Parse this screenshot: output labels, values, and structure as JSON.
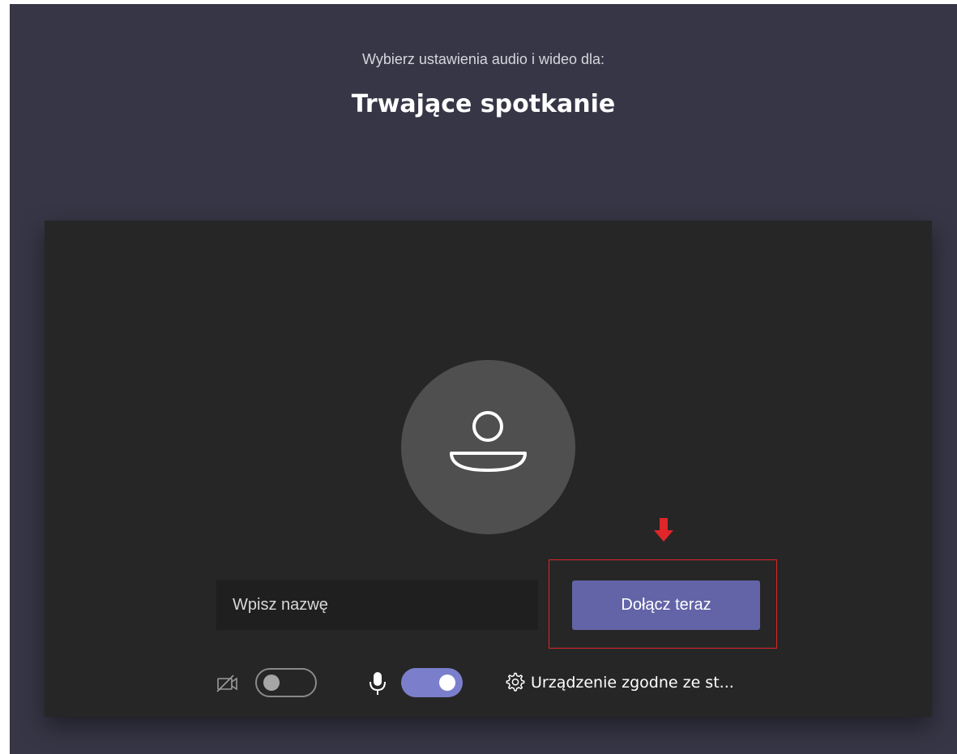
{
  "header": {
    "subtitle": "Wybierz ustawienia audio i wideo dla:",
    "title": "Trwające spotkanie"
  },
  "name_input": {
    "placeholder": "Wpisz nazwę",
    "value": ""
  },
  "join_button": {
    "label": "Dołącz teraz"
  },
  "controls": {
    "camera": {
      "icon": "camera-off-icon",
      "enabled": false
    },
    "microphone": {
      "icon": "microphone-icon",
      "enabled": true
    },
    "device_settings": {
      "icon": "gear-icon",
      "label": "Urządzenie zgodne ze st..."
    }
  },
  "avatar": {
    "icon": "person-icon"
  },
  "annotation": {
    "icon": "red-down-arrow-icon"
  },
  "colors": {
    "background": "#373646",
    "preview": "#262626",
    "avatar": "#4f4f4f",
    "join_button": "#6264a7",
    "toggle_on": "#7b7fcb",
    "annotation": "#e0262a"
  }
}
